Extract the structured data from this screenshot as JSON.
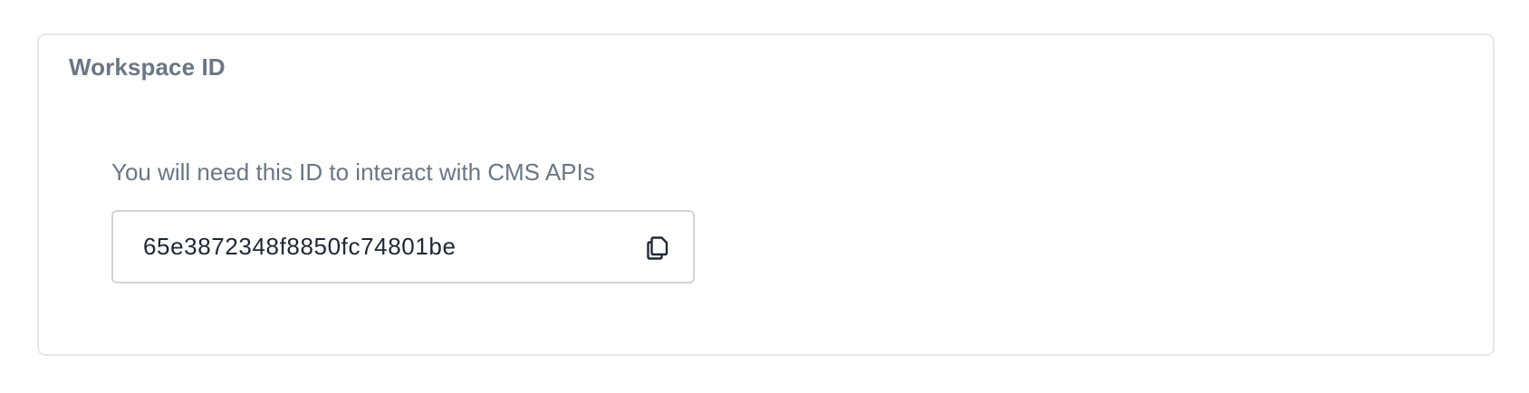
{
  "workspace_card": {
    "title": "Workspace ID",
    "helper_text": "You will need this ID to interact with CMS APIs",
    "workspace_id": "65e3872348f8850fc74801be",
    "copy_icon": "copy-icon"
  },
  "colors": {
    "card_border": "#e4e7eb",
    "field_border": "#cfd4db",
    "muted_text": "#6b7683",
    "value_text": "#1f2733"
  }
}
